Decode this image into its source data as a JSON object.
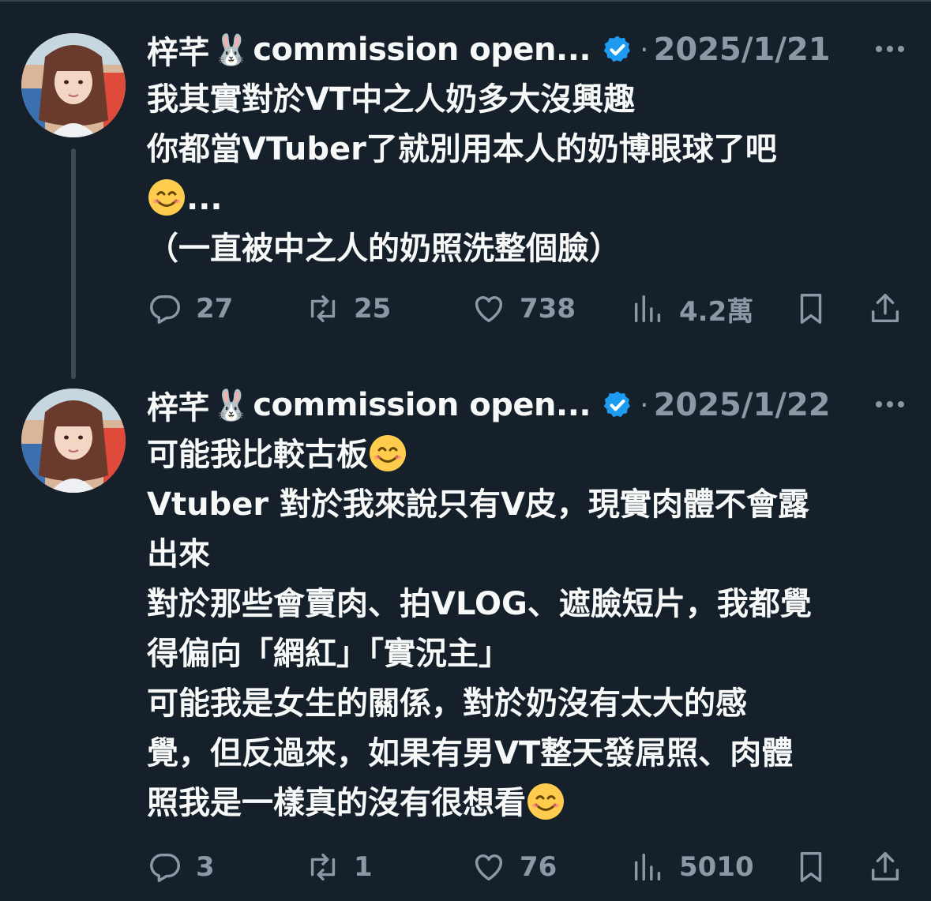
{
  "tweets": [
    {
      "author": "梓芊",
      "author_rabbit": "🐰",
      "handle_tail": "commission open...",
      "date": "2025/1/21",
      "lines": [
        "我其實對於VT中之人奶多大沒興趣",
        "你都當VTuber了就別用本人的奶博眼球了吧",
        "...",
        "（一直被中之人的奶照洗整個臉）"
      ],
      "stats": {
        "replies": "27",
        "retweets": "25",
        "likes": "738",
        "views": "4.2萬"
      }
    },
    {
      "author": "梓芊",
      "author_rabbit": "🐰",
      "handle_tail": "commission open...",
      "date": "2025/1/22",
      "lines": [
        "可能我比較古板",
        "Vtuber 對於我來說只有V皮，現實肉體不會露",
        "出來",
        "對於那些會賣肉、拍VLOG、遮臉短片，我都覺",
        "得偏向「網紅」「實況主」",
        "可能我是女生的關係，對於奶沒有太大的感",
        "覺，但反過來，如果有男VT整天發屌照、肉體",
        "照我是一樣真的沒有很想看"
      ],
      "stats": {
        "replies": "3",
        "retweets": "1",
        "likes": "76",
        "views": "5010"
      }
    }
  ],
  "separator": "·",
  "icons": {
    "emoji": "smiling-face-emoji",
    "verified": "verified-badge-icon",
    "more": "more-options-icon",
    "reply": "reply-icon",
    "retweet": "retweet-icon",
    "like": "heart-icon",
    "views": "views-chart-icon",
    "bookmark": "bookmark-icon",
    "share": "share-icon"
  },
  "colors": {
    "background": "#15202b",
    "text": "#f7f9f9",
    "muted": "#8b98a5",
    "verified": "#1d9bf0",
    "thread_line": "#3d4a55"
  }
}
